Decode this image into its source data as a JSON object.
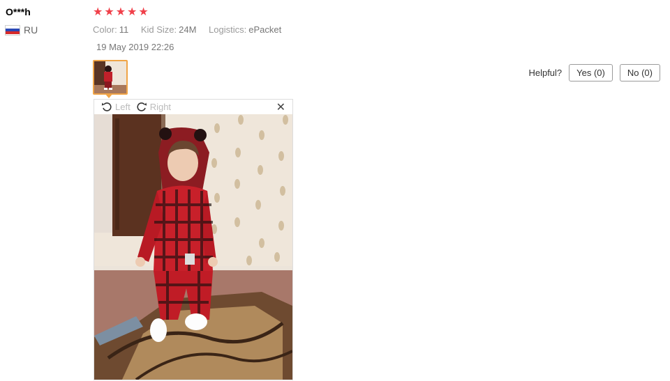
{
  "review": {
    "username": "O***h",
    "country_code": "RU",
    "rating": 5,
    "attributes": [
      {
        "name": "Color:",
        "value": "11"
      },
      {
        "name": "Kid Size:",
        "value": "24M"
      },
      {
        "name": "Logistics:",
        "value": "ePacket"
      }
    ],
    "date": "19 May 2019 22:26"
  },
  "helpful": {
    "label": "Helpful?",
    "yes_label": "Yes (0)",
    "no_label": "No (0)"
  },
  "viewer": {
    "rotate_left_label": "Left",
    "rotate_right_label": "Right",
    "close_icon": "close-icon"
  },
  "colors": {
    "star": "#f0404a",
    "thumb_border": "#f0a446"
  }
}
